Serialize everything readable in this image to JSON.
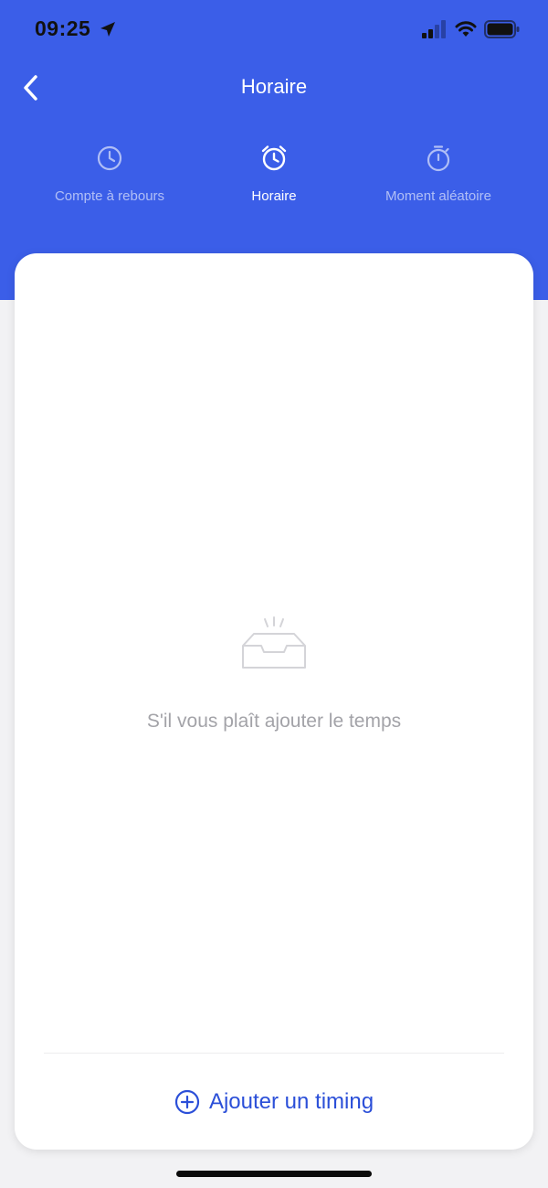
{
  "status_bar": {
    "time": "09:25",
    "icons": [
      "location-arrow-icon",
      "cellular-signal-icon",
      "wifi-icon",
      "battery-icon"
    ]
  },
  "nav": {
    "title": "Horaire",
    "back_icon": "chevron-left-icon"
  },
  "tabs": [
    {
      "label": "Compte à rebours",
      "icon": "clock-icon",
      "active": false
    },
    {
      "label": "Horaire",
      "icon": "alarm-clock-icon",
      "active": true
    },
    {
      "label": "Moment aléatoire",
      "icon": "stopwatch-icon",
      "active": false
    }
  ],
  "empty_state": {
    "icon": "empty-inbox-icon",
    "message": "S'il vous plaît ajouter le temps"
  },
  "add_button": {
    "icon": "plus-circle-icon",
    "label": "Ajouter un timing"
  },
  "colors": {
    "header_blue": "#3b5ee8",
    "accent_blue": "#2b4fd8",
    "background": "#f2f2f4",
    "card": "#ffffff",
    "muted_text": "#a3a3a8"
  }
}
